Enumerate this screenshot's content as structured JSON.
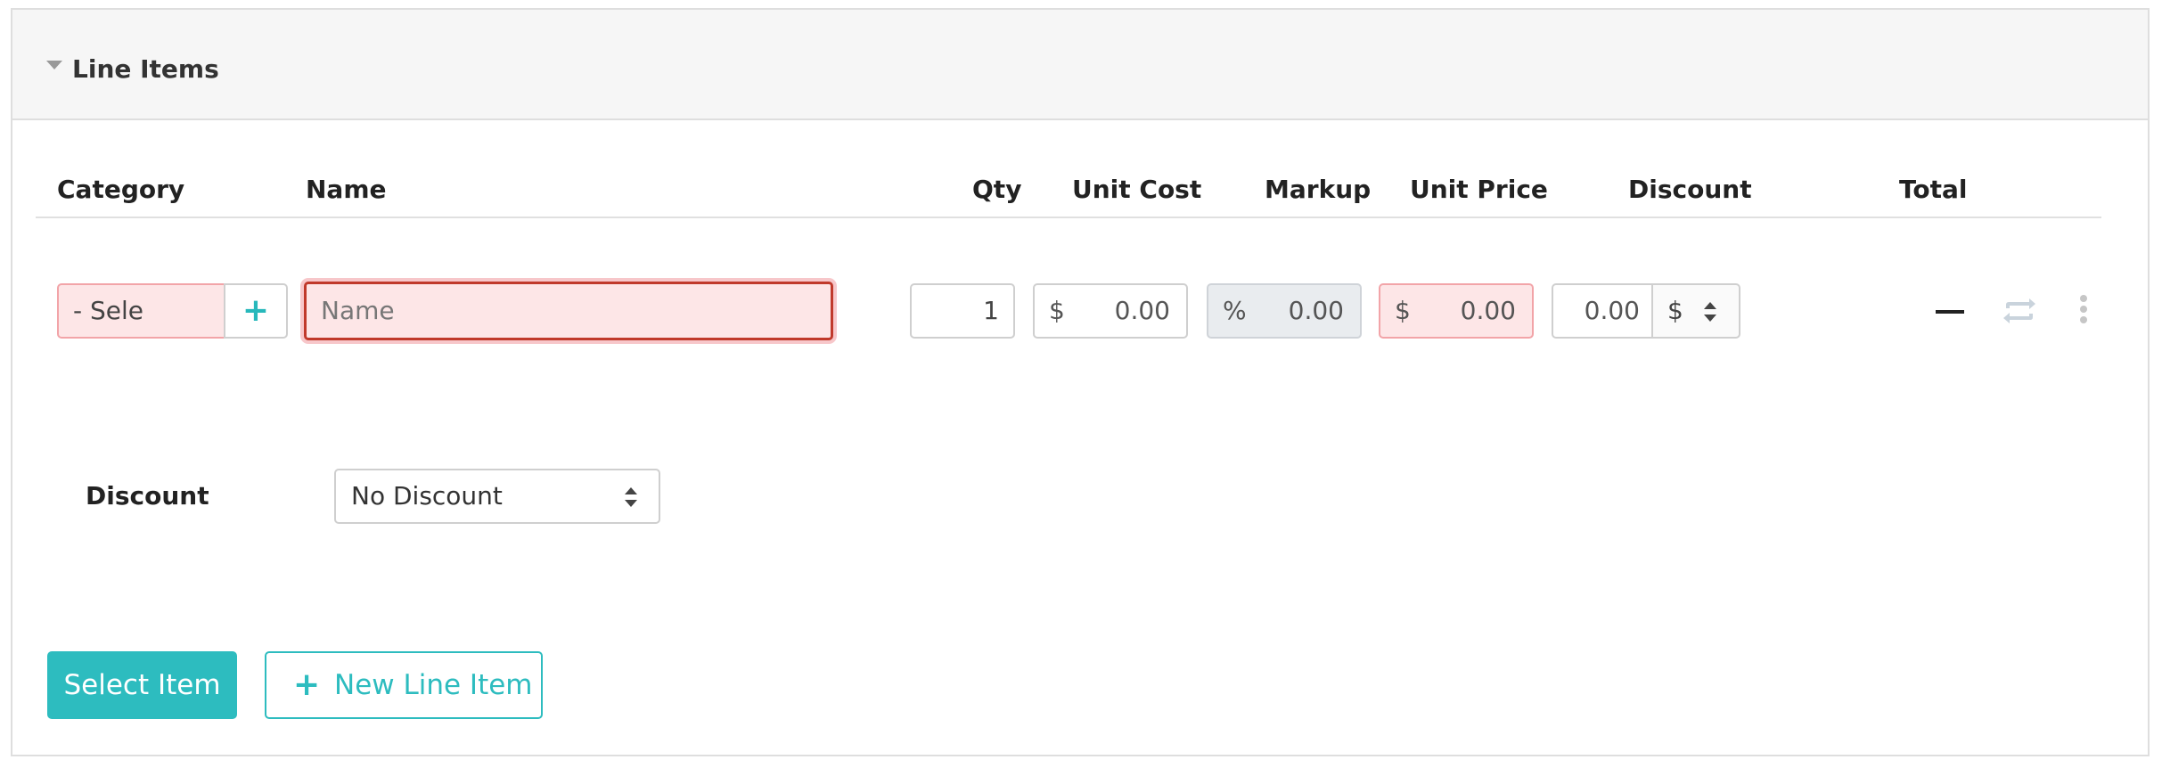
{
  "section": {
    "title": "Line Items"
  },
  "columns": {
    "category": "Category",
    "name": "Name",
    "qty": "Qty",
    "unit_cost": "Unit Cost",
    "markup": "Markup",
    "unit_price": "Unit Price",
    "discount": "Discount",
    "total": "Total"
  },
  "row": {
    "category_value": "- Sele",
    "add_category": "+",
    "name_placeholder": "Name",
    "qty": "1",
    "unit_cost_prefix": "$",
    "unit_cost": "0.00",
    "markup_prefix": "%",
    "markup": "0.00",
    "unit_price_prefix": "$",
    "unit_price": "0.00",
    "discount": "0.00",
    "discount_unit": "$",
    "total": "—"
  },
  "discount_section": {
    "label": "Discount",
    "selected": "No Discount"
  },
  "actions": {
    "select_item": "Select Item",
    "new_line_plus": "+",
    "new_line_item": "New Line Item"
  },
  "colors": {
    "accent": "#2dbcbf",
    "error_bg": "#fde6e7",
    "error_border": "#f2a4a8",
    "focus_border": "#c0392b"
  },
  "icons": {
    "collapse": "caret-down-icon",
    "repeat": "repeat-icon",
    "more": "more-vertical-icon",
    "select_arrows": "sort-arrows-icon"
  }
}
